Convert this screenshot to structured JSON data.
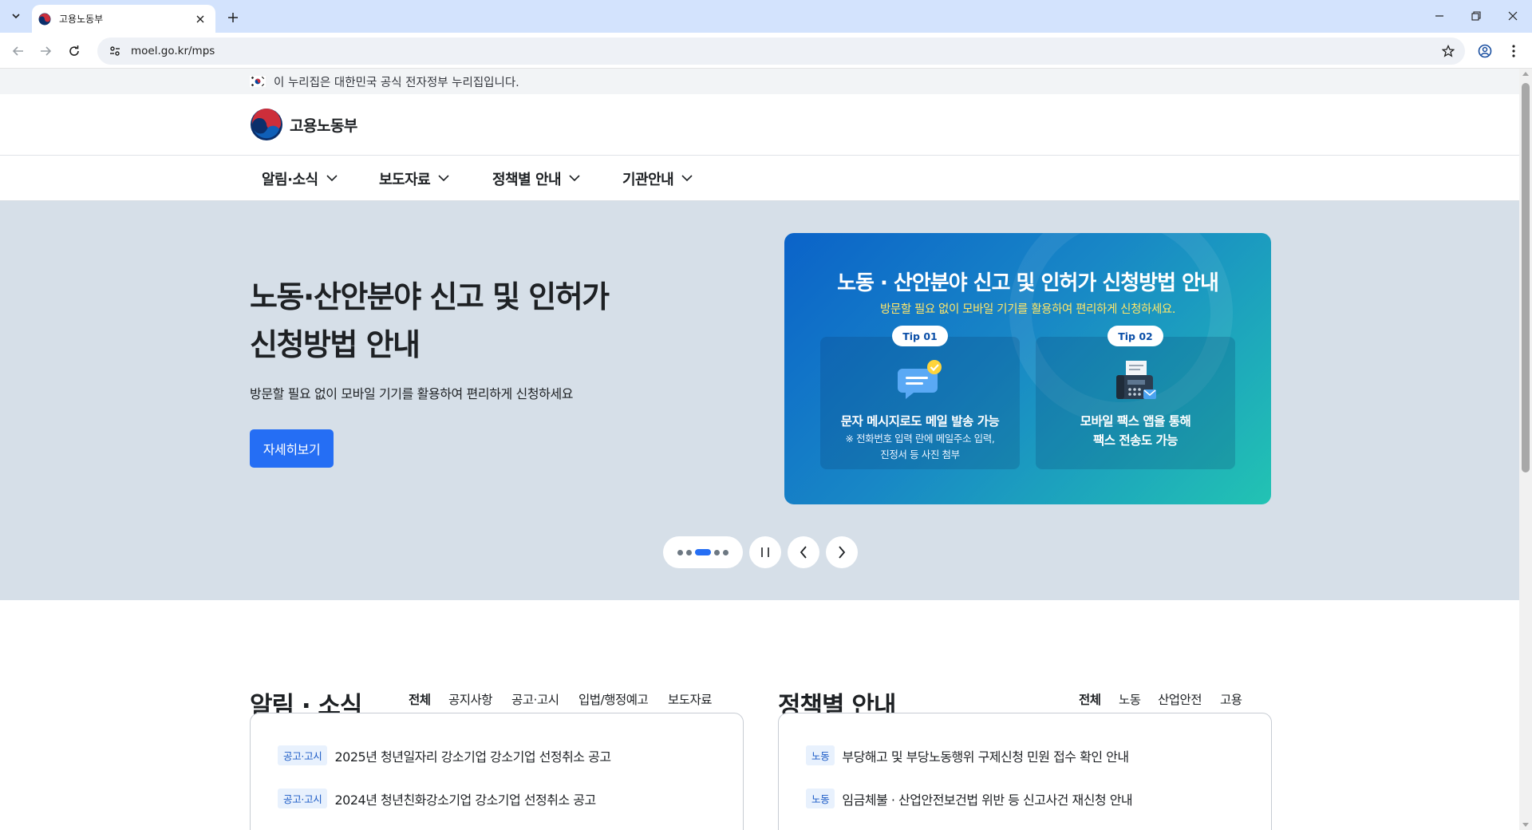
{
  "browser": {
    "tab_title": "고용노동부",
    "url": "moel.go.kr/mps"
  },
  "gov_banner": {
    "text": "이 누리집은 대한민국 공식 전자정부 누리집입니다."
  },
  "header": {
    "logo_text": "고용노동부"
  },
  "gnb": {
    "items": [
      {
        "label": "알림·소식"
      },
      {
        "label": "보도자료"
      },
      {
        "label": "정책별 안내"
      },
      {
        "label": "기관안내"
      }
    ]
  },
  "hero": {
    "title_line1": "노동·산안분야 신고 및 인허가",
    "title_line2": "신청방법 안내",
    "subtitle": "방문할 필요 없이 모바일 기기를 활용하여 편리하게 신청하세요",
    "button_label": "자세히보기",
    "button_color": "#256ef4",
    "background_color": "#d6dfe8"
  },
  "banner": {
    "title": "노동 · 산안분야 신고 및 인허가 신청방법 안내",
    "subtitle": "방문할 필요 없이 모바일 기기를 활용하여 편리하게 신청하세요.",
    "tips": [
      {
        "pill": "Tip 01",
        "main": "문자 메시지로도 메일 발송 가능",
        "note_line1": "※ 전화번호 입력 란에 메일주소 입력,",
        "note_line2": "진정서 등 사진 첨부",
        "icon": "chat-message-icon"
      },
      {
        "pill": "Tip 02",
        "main_line1": "모바일 팩스 앱을 통해",
        "main_line2": "팩스 전송도 가능",
        "icon": "fax-machine-icon"
      }
    ]
  },
  "slider": {
    "total": 5,
    "current": 3
  },
  "news": {
    "title": "알림 · 소식",
    "tabs": [
      "전체",
      "공지사항",
      "공고·고시",
      "입법/행정예고",
      "보도자료"
    ],
    "rows": [
      {
        "badge": "공고·고시",
        "text": "2025년 청년일자리 강소기업 강소기업 선정취소 공고"
      },
      {
        "badge": "공고·고시",
        "text": "2024년 청년친화강소기업 강소기업 선정취소 공고"
      }
    ]
  },
  "policy": {
    "title": "정책별 안내",
    "tabs": [
      "전체",
      "노동",
      "산업안전",
      "고용"
    ],
    "rows": [
      {
        "badge": "노동",
        "text": "부당해고 및 부당노동행위 구제신청 민원 접수 확인 안내"
      },
      {
        "badge": "노동",
        "text": "임금체불 · 산업안전보건법 위반 등 신고사건 재신청 안내"
      }
    ]
  }
}
